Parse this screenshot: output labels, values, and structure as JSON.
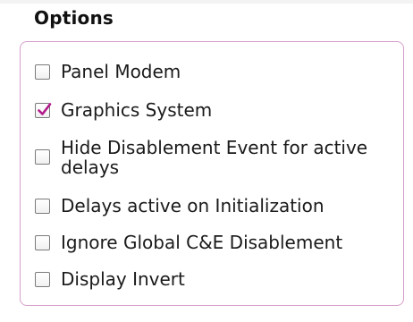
{
  "panel": {
    "title": "Options",
    "accent_color": "#d69ec8",
    "check_color": "#b21a8a"
  },
  "options": [
    {
      "label": "Panel Modem",
      "checked": false
    },
    {
      "label": "Graphics System",
      "checked": true
    },
    {
      "label": "Hide Disablement Event for active\ndelays",
      "checked": false
    },
    {
      "label": "Delays active on Initialization",
      "checked": false
    },
    {
      "label": "Ignore Global C&E Disablement",
      "checked": false
    },
    {
      "label": "Display Invert",
      "checked": false
    }
  ]
}
